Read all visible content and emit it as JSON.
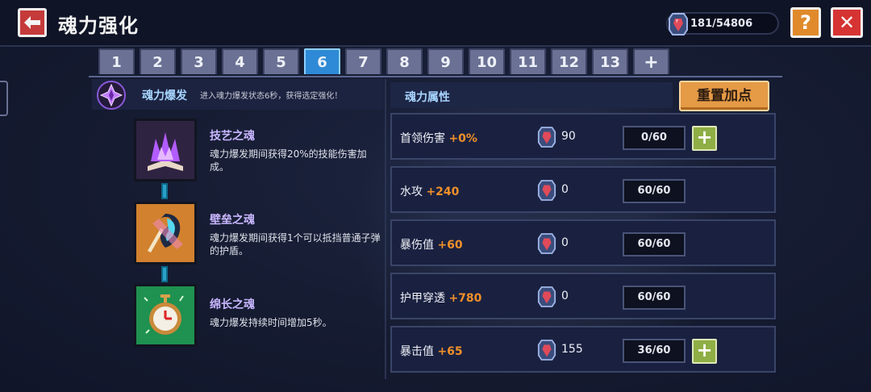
{
  "header": {
    "title": "魂力强化",
    "currency": "181/54806",
    "help_label": "?",
    "close_label": "✕"
  },
  "tabs": [
    "1",
    "2",
    "3",
    "4",
    "5",
    "6",
    "7",
    "8",
    "9",
    "10",
    "11",
    "12",
    "13",
    "+"
  ],
  "active_tab": "6",
  "burst": {
    "title": "魂力爆发",
    "desc": "进入魂力爆发状态6秒，获得选定强化！"
  },
  "souls": [
    {
      "name": "技艺之魂",
      "desc": "魂力爆发期间获得20%的技能伤害加成。"
    },
    {
      "name": "壁垒之魂",
      "desc": "魂力爆发期间获得1个可以抵挡普通子弹的护盾。"
    },
    {
      "name": "绵长之魂",
      "desc": "魂力爆发持续时间增加5秒。"
    }
  ],
  "attributes": {
    "header": "魂力属性",
    "reset_label": "重置加点",
    "rows": [
      {
        "name": "首领伤害",
        "bonus": "+0%",
        "cost": "90",
        "level": "0/60",
        "plus": "+"
      },
      {
        "name": "水攻",
        "bonus": "+240",
        "cost": "0",
        "level": "60/60"
      },
      {
        "name": "暴伤值",
        "bonus": "+60",
        "cost": "0",
        "level": "60/60"
      },
      {
        "name": "护甲穿透",
        "bonus": "+780",
        "cost": "0",
        "level": "60/60"
      },
      {
        "name": "暴击值",
        "bonus": "+65",
        "cost": "155",
        "level": "36/60",
        "plus": "+"
      }
    ]
  },
  "colors": {
    "accent_orange": "#f0902a",
    "active_tab": "#2e8ad6",
    "plus_green": "#8fae45",
    "close_red": "#d63333"
  }
}
